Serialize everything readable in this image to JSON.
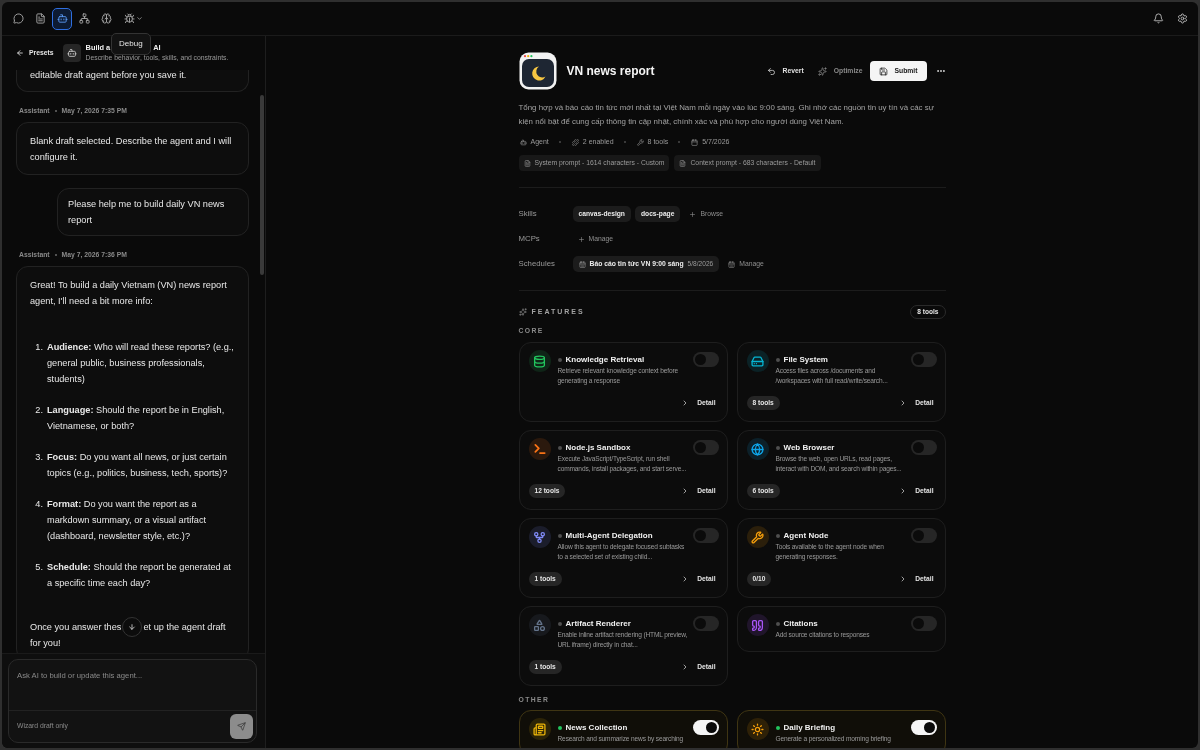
{
  "top_bar": {
    "tools": [
      {
        "selected": false
      },
      {
        "selected": false
      },
      {
        "selected": true
      },
      {
        "selected": false
      },
      {
        "selected": false
      },
      {
        "selected": false
      }
    ],
    "tooltip": "Debug"
  },
  "sidebar": {
    "back_link": "Presets",
    "title_parts": [
      "Build a",
      "AI"
    ],
    "subtitle": "Describe behavior, tools, skills, and constraints.",
    "messages": [
      {
        "kind": "fragment",
        "text": "editable draft agent before you save it."
      },
      {
        "kind": "assistant",
        "author": "Assistant",
        "time": "May 7, 2026 7:35 PM",
        "text": "Blank draft selected. Describe the agent and I will configure it."
      },
      {
        "kind": "user",
        "text": "Please help me to build daily VN news report"
      },
      {
        "kind": "assistant",
        "author": "Assistant",
        "time": "May 7, 2026 7:36 PM",
        "text": "Great! To build a daily Vietnam (VN) news report agent, I'll need a bit more info:",
        "list": [
          {
            "number": "1.",
            "text": "**Audience:** Who will read these reports? (e.g., general public, business professionals, students)"
          },
          {
            "number": "2.",
            "text": "**Language:** Should the report be in English, Vietnamese, or both?"
          },
          {
            "number": "3.",
            "text": "**Focus:** Do you want all news, or just certain topics (e.g., politics, business, tech, sports)?"
          },
          {
            "number": "4.",
            "text": "**Format:** Do you want the report as a markdown summary, or a visual artifact (dashboard, newsletter style, etc.)?"
          },
          {
            "number": "5.",
            "text": "**Schedule:** Should the report be generated at a specific time each day?"
          }
        ],
        "closing": [
          "Once you answer thes",
          "et up the agent draft",
          "for you!"
        ]
      }
    ],
    "composer": {
      "placeholder": "Ask AI to build or update this agent...",
      "footnote": "Wizard draft only"
    }
  },
  "agent": {
    "name": "VN news report",
    "actions": [
      {
        "label": "Revert",
        "kind": "ghost",
        "disabled": false
      },
      {
        "label": "Optimize",
        "kind": "ghost",
        "disabled": true
      },
      {
        "label": "Submit",
        "kind": "primary",
        "disabled": false
      }
    ],
    "description": "Tổng hợp và báo cáo tin tức mới nhất tại Việt Nam mỗi ngày vào lúc 9:00 sáng. Ghi nhớ các nguồn tin uy tín và các sự kiện nổi bật để cung cấp thông tin cập nhật, chính xác và phù hợp cho người dùng Việt Nam.",
    "meta": [
      "Agent",
      "2 enabled",
      "8 tools",
      "5/7/2026"
    ],
    "prompts": [
      "System prompt - 1614 characters - Custom",
      "Context prompt - 683 characters - Default"
    ],
    "skills": {
      "label": "Skills",
      "items": [
        "canvas-design",
        "docs-page"
      ],
      "action": "Browse"
    },
    "mcps": {
      "label": "MCPs",
      "action": "Manage"
    },
    "schedules": {
      "label": "Schedules",
      "items": [
        {
          "name": "Báo cáo tin tức VN 9:00 sáng",
          "date": "5/8/2026"
        }
      ],
      "action": "Manage"
    }
  },
  "features": {
    "title": "FEATURES",
    "count": "8 tools",
    "groups": [
      {
        "label": "CORE",
        "items": [
          {
            "name": "Knowledge Retrieval",
            "description": "Retrieve relevant knowledge context before generating a response",
            "enabled": false,
            "color": "#22c55e",
            "detail": "Detail"
          },
          {
            "name": "File System",
            "description": "Access files across /documents and /workspaces with full read/write/search...",
            "enabled": false,
            "color": "#06b6d4",
            "tools": "8 tools",
            "detail": "Detail"
          },
          {
            "name": "Node.js Sandbox",
            "description": "Execute JavaScript/TypeScript, run shell commands, install packages, and start serve...",
            "enabled": false,
            "color": "#f97316",
            "tools": "12 tools",
            "detail": "Detail"
          },
          {
            "name": "Web Browser",
            "description": "Browse the web, open URLs, read pages, interact with DOM, and search within pages...",
            "enabled": false,
            "color": "#0ea5e9",
            "tools": "6 tools",
            "detail": "Detail"
          },
          {
            "name": "Multi-Agent Delegation",
            "description": "Allow this agent to delegate focused subtasks to a selected set of existing child...",
            "enabled": false,
            "color": "#818cf8",
            "tools": "1 tools",
            "detail": "Detail"
          },
          {
            "name": "Agent Node",
            "description": "Tools available to the agent node when generating responses.",
            "enabled": false,
            "color": "#f59e0b",
            "tools": "0/10",
            "detail": "Detail"
          },
          {
            "name": "Artifact Renderer",
            "description": "Enable inline artifact rendering (HTML preview, URL iframe) directly in chat...",
            "enabled": false,
            "color": "#64748b",
            "tools": "1 tools",
            "detail": "Detail"
          },
          {
            "name": "Citations",
            "description": "Add source citations to responses",
            "enabled": false,
            "color": "#a855f7"
          }
        ]
      },
      {
        "label": "OTHER",
        "items": [
          {
            "name": "News Collection",
            "description": "Research and summarize news by searching",
            "enabled": true,
            "color": "#eab308"
          },
          {
            "name": "Daily Briefing",
            "description": "Generate a personalized morning briefing",
            "enabled": true,
            "color": "#f59e0b"
          }
        ]
      }
    ]
  }
}
